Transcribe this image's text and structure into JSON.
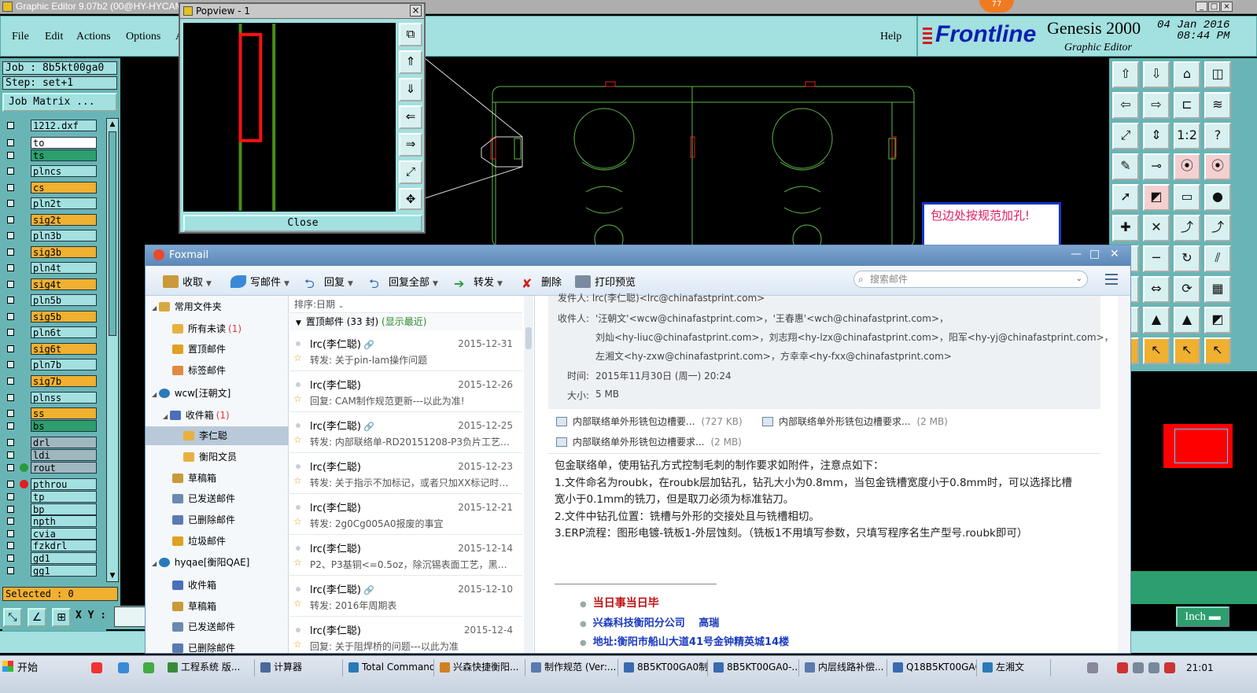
{
  "ge": {
    "title": "Graphic Editor 9.07b2 (00@HY-HYCAM",
    "menu": [
      "File",
      "Edit",
      "Actions",
      "Options",
      "A"
    ],
    "help": "Help",
    "brand": {
      "frontline": "Frontline",
      "product": "Genesis 2000",
      "subtitle": "Graphic Editor",
      "date": "04 Jan 2016",
      "time": "08:44 PM"
    },
    "job": "Job : 8b5kt00ga0",
    "step": "Step: set+1",
    "job_matrix": "Job Matrix ...",
    "layers": [
      {
        "name": "1212.dxf",
        "color": "#a3e0e0"
      },
      {
        "name": "to",
        "color": "#ffffff"
      },
      {
        "name": "ts",
        "color": "#2d9e6e"
      },
      {
        "name": "plncs",
        "color": "#a3e0e0"
      },
      {
        "name": "cs",
        "color": "#f0b030"
      },
      {
        "name": "pln2t",
        "color": "#a3e0e0"
      },
      {
        "name": "sig2t",
        "color": "#f0b030"
      },
      {
        "name": "pln3b",
        "color": "#a3e0e0"
      },
      {
        "name": "sig3b",
        "color": "#f0b030"
      },
      {
        "name": "pln4t",
        "color": "#a3e0e0"
      },
      {
        "name": "sig4t",
        "color": "#f0b030"
      },
      {
        "name": "pln5b",
        "color": "#a3e0e0"
      },
      {
        "name": "sig5b",
        "color": "#f0b030"
      },
      {
        "name": "pln6t",
        "color": "#a3e0e0"
      },
      {
        "name": "sig6t",
        "color": "#f0b030"
      },
      {
        "name": "pln7b",
        "color": "#a3e0e0"
      },
      {
        "name": "sig7b",
        "color": "#f0b030"
      },
      {
        "name": "plnss",
        "color": "#a3e0e0"
      },
      {
        "name": "ss",
        "color": "#f0b030"
      },
      {
        "name": "bs",
        "color": "#2d9e6e"
      },
      {
        "name": "drl",
        "color": "#9fb8c0"
      },
      {
        "name": "ldi",
        "color": "#9fb8c0"
      },
      {
        "name": "rout",
        "color": "#9fb8c0"
      },
      {
        "name": "pthrou",
        "color": "#a3e0e0"
      },
      {
        "name": "tp",
        "color": "#a3e0e0"
      },
      {
        "name": "bp",
        "color": "#a3e0e0"
      },
      {
        "name": "npth",
        "color": "#a3e0e0"
      },
      {
        "name": "cvia",
        "color": "#a3e0e0"
      },
      {
        "name": "fzkdrl",
        "color": "#a3e0e0"
      },
      {
        "name": "gd1",
        "color": "#a3e0e0"
      },
      {
        "name": "gg1",
        "color": "#a3e0e0"
      }
    ],
    "selected": "Selected : 0",
    "xy_label": "X Y :",
    "unit": "Inch",
    "annotation": "包边处按规范加孔!",
    "badge": "77"
  },
  "popview": {
    "title": "Popview - 1",
    "close": "Close"
  },
  "foxmail": {
    "title": "Foxmail",
    "toolbar": [
      "收取",
      "写邮件",
      "回复",
      "回复全部",
      "转发",
      "删除",
      "打印预览"
    ],
    "search_placeholder": "搜索邮件",
    "folders": [
      {
        "label": "常用文件夹",
        "count": ""
      },
      {
        "label": "所有未读",
        "count": "(1)"
      },
      {
        "label": "置顶邮件",
        "count": ""
      },
      {
        "label": "标签邮件",
        "count": ""
      },
      {
        "label": "wcw[汪朝文]",
        "count": ""
      },
      {
        "label": "收件箱",
        "count": "(1)"
      },
      {
        "label": "李仁聪",
        "count": ""
      },
      {
        "label": "衡阳文员",
        "count": ""
      },
      {
        "label": "草稿箱",
        "count": ""
      },
      {
        "label": "已发送邮件",
        "count": ""
      },
      {
        "label": "已删除邮件",
        "count": ""
      },
      {
        "label": "垃圾邮件",
        "count": ""
      },
      {
        "label": "hyqae[衡阳QAE]",
        "count": ""
      },
      {
        "label": "收件箱",
        "count": ""
      },
      {
        "label": "草稿箱",
        "count": ""
      },
      {
        "label": "已发送邮件",
        "count": ""
      },
      {
        "label": "已删除邮件",
        "count": ""
      }
    ],
    "sort": "排序:日期",
    "pinned": {
      "label": "置顶邮件 (33 封)",
      "link": "(显示最近)"
    },
    "mails": [
      {
        "from": "lrc(李仁聪)",
        "date": "2015-12-31",
        "subject": "转发: 关于pin-lam操作问题",
        "clip": "🔗"
      },
      {
        "from": "lrc(李仁聪)",
        "date": "2015-12-26",
        "subject": "回复: CAM制作规范更新---以此为准!",
        "clip": ""
      },
      {
        "from": "lrc(李仁聪)",
        "date": "2015-12-25",
        "subject": "转发: 内部联络单-RD20151208-P3负片工艺能...",
        "clip": "🔗"
      },
      {
        "from": "lrc(李仁聪)",
        "date": "2015-12-23",
        "subject": "转发: 关于指示不加标记，或者只加XX标记时是...",
        "clip": ""
      },
      {
        "from": "lrc(李仁聪)",
        "date": "2015-12-21",
        "subject": "转发: 2g0Cg005A0报废的事宜",
        "clip": ""
      },
      {
        "from": "lrc(李仁聪)",
        "date": "2015-12-14",
        "subject": "P2、P3基铜<=0.5oz，除沉锡表面工艺，黑色...",
        "clip": ""
      },
      {
        "from": "lrc(李仁聪)",
        "date": "2015-12-10",
        "subject": "转发: 2016年周期表",
        "clip": "🔗"
      },
      {
        "from": "lrc(李仁聪)",
        "date": "2015-12-4",
        "subject": "回复: 关于阻焊桥的问题---以此为准",
        "clip": ""
      }
    ],
    "header": {
      "from": "发件人: lrc(李仁聪)<lrc@chinafastprint.com>",
      "to_label": "收件人:",
      "to1": "'汪朝文'<wcw@chinafastprint.com>，'王春惠'<wch@chinafastprint.com>，",
      "to2": "刘灿<hy-liuc@chinafastprint.com>，刘志翔<hy-lzx@chinafastprint.com>，阳军<hy-yj@chinafastprint.com>，",
      "to3": "左湘文<hy-zxw@chinafastprint.com>，方幸幸<hy-fxx@chinafastprint.com>",
      "time_label": "时间:",
      "time": "2015年11月30日 (周一) 20:24",
      "size_label": "大小:",
      "size": "5 MB"
    },
    "attachments": [
      {
        "name": "内部联络单外形铣包边槽要...",
        "size": "(727 KB)"
      },
      {
        "name": "内部联络单外形铣包边槽要求...",
        "size": "(2 MB)"
      },
      {
        "name": "内部联络单外形铣包边槽要求...",
        "size": "(2 MB)"
      }
    ],
    "body": [
      "包金联络单，使用钻孔方式控制毛刺的制作要求如附件，注意点如下：",
      "1.文件命名为roubk，在roubk层加钻孔，钻孔大小为0.8mm，当包金铣槽宽度小于0.8mm时，可以选择比槽宽小于0.1mm的铣刀，但是取刀必须为标准钻刀。",
      "2.文件中钻孔位置：铣槽与外形的交接处且与铣槽相切。",
      "3.ERP流程：图形电镀-铣板1-外层蚀刻。（铣板1不用填写参数，只填写程序名生产型号.roubk即可）"
    ],
    "signature": [
      "当日事当日毕",
      "兴森科技衡阳分公司　 高瑞",
      "地址:衡阳市船山大道41号金钟精英城14楼"
    ]
  },
  "taskbar": {
    "start": "开始",
    "tasks": [
      "工程系统  版...",
      "计算器",
      "Total Command...",
      "兴森快捷衡阳...",
      "制作规范 (Ver:...",
      "8B5KT00GA0制...",
      "8B5KT00GA0-...",
      "内层线路补偿...",
      "Q18B5KT00GA0...",
      "左湘文"
    ],
    "clock": "21:01"
  }
}
